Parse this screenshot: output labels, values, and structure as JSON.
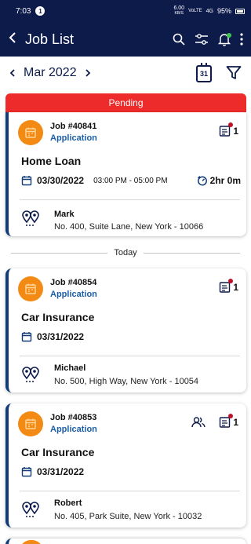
{
  "status_bar": {
    "time": "7:03",
    "notif_badge": "1",
    "net_speed_top": "6.00",
    "net_speed_unit": "KB/S",
    "network_1": "VoLTE",
    "network_2": "4G",
    "battery": "95%"
  },
  "app_bar": {
    "title": "Job List",
    "back_icon": "back-arrow",
    "icons": [
      "search-icon",
      "filter-sliders-icon",
      "bell-icon",
      "more-vert-icon"
    ],
    "notification_dot_color": "#3ec84b"
  },
  "date_bar": {
    "month": "Mar 2022",
    "calendar_day": "31",
    "prev_icon": "chevron-left",
    "next_icon": "chevron-right"
  },
  "sections": {
    "pending_label": "Pending",
    "today_label": "Today"
  },
  "jobs": [
    {
      "job_no": "Job #40841",
      "type": "Application",
      "service": "Home Loan",
      "date": "03/30/2022",
      "time_range": "03:00 PM - 05:00 PM",
      "duration": "2hr 0m",
      "notes_count": "1",
      "customer": "Mark",
      "address": "No. 400, Suite Lane, New York - 10066"
    },
    {
      "job_no": "Job #40854",
      "type": "Application",
      "service": "Car Insurance",
      "date": "03/31/2022",
      "notes_count": "1",
      "customer": "Michael",
      "address": "No. 500, High Way, New York - 10054"
    },
    {
      "job_no": "Job #40853",
      "type": "Application",
      "service": "Car Insurance",
      "date": "03/31/2022",
      "notes_count": "1",
      "customer": "Robert",
      "address": "No. 405, Park Suite, New York - 10032"
    }
  ],
  "colors": {
    "header_bg": "#0d1b4b",
    "pending_red": "#ee2b2b",
    "job_badge_orange": "#f28a14",
    "type_blue": "#1b5ea8",
    "card_accent": "#123c78"
  }
}
